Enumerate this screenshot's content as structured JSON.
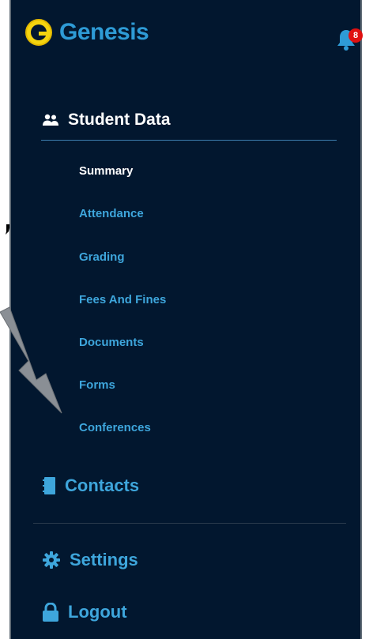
{
  "app": {
    "name": "Genesis",
    "notification_count": "8"
  },
  "section": {
    "title": "Student Data",
    "icon": "users-icon"
  },
  "sub_items": [
    {
      "label": "Summary",
      "active": true
    },
    {
      "label": "Attendance",
      "active": false
    },
    {
      "label": "Grading",
      "active": false
    },
    {
      "label": "Fees And Fines",
      "active": false
    },
    {
      "label": "Documents",
      "active": false
    },
    {
      "label": "Forms",
      "active": false
    },
    {
      "label": "Conferences",
      "active": false
    }
  ],
  "main_items": [
    {
      "label": "Contacts",
      "icon": "address-book-icon"
    },
    {
      "label": "Settings",
      "icon": "gear-icon"
    },
    {
      "label": "Logout",
      "icon": "lock-icon"
    }
  ],
  "colors": {
    "panel_bg": "#02172f",
    "accent": "#3ea6dc",
    "logo_yellow": "#f5d40f",
    "badge_red": "#e01010"
  }
}
